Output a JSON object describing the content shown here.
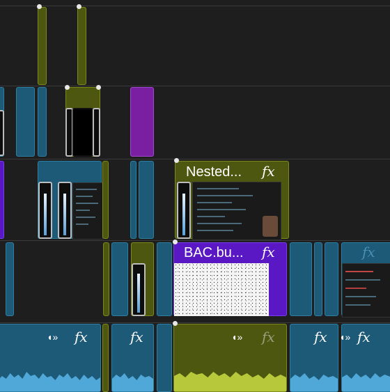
{
  "timeline": {
    "clips": {
      "nested_label": "Nested...",
      "bac_label": "BAC.bu...",
      "fx_symbol": "fx",
      "speaker_symbol": "◖»"
    }
  },
  "colors": {
    "background": "#1e1e1e",
    "video_clip_blue": "#1c5a78",
    "nested_olive": "#4e5710",
    "adjustment_purple": "#7b1fa2",
    "bac_violet": "#5a18c4",
    "audio_waveform": "#4fa8d8",
    "audio_waveform_green": "#b7c93a"
  }
}
